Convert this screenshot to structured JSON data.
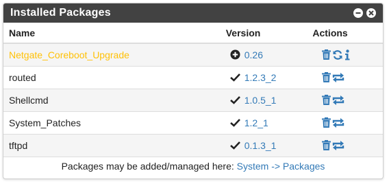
{
  "widget": {
    "title": "Installed Packages",
    "minimize_icon": "minus-circle-icon",
    "close_icon": "close-circle-icon"
  },
  "table": {
    "headers": {
      "name": "Name",
      "version": "Version",
      "actions": "Actions"
    },
    "rows": [
      {
        "name": "Netgate_Coreboot_Upgrade",
        "status": "upgrade-available",
        "status_icon": "plus-circle-icon",
        "version": "0.26",
        "actions": [
          "trash-icon",
          "reinstall-icon",
          "info-icon"
        ]
      },
      {
        "name": "routed",
        "status": "up-to-date",
        "status_icon": "check-icon",
        "version": "1.2.3_2",
        "actions": [
          "trash-icon",
          "reinstall-icon"
        ]
      },
      {
        "name": "Shellcmd",
        "status": "up-to-date",
        "status_icon": "check-icon",
        "version": "1.0.5_1",
        "actions": [
          "trash-icon",
          "reinstall-icon"
        ]
      },
      {
        "name": "System_Patches",
        "status": "up-to-date",
        "status_icon": "check-icon",
        "version": "1.2_1",
        "actions": [
          "trash-icon",
          "reinstall-icon"
        ]
      },
      {
        "name": "tftpd",
        "status": "up-to-date",
        "status_icon": "check-icon",
        "version": "0.1.3_1",
        "actions": [
          "trash-icon",
          "reinstall-icon"
        ]
      }
    ]
  },
  "footer": {
    "text": "Packages may be added/managed here: ",
    "link_text": "System -> Packages"
  },
  "colors": {
    "header_bg": "#424242",
    "link": "#337ab7",
    "upgrade_name": "#ffc107",
    "text": "#222222"
  }
}
